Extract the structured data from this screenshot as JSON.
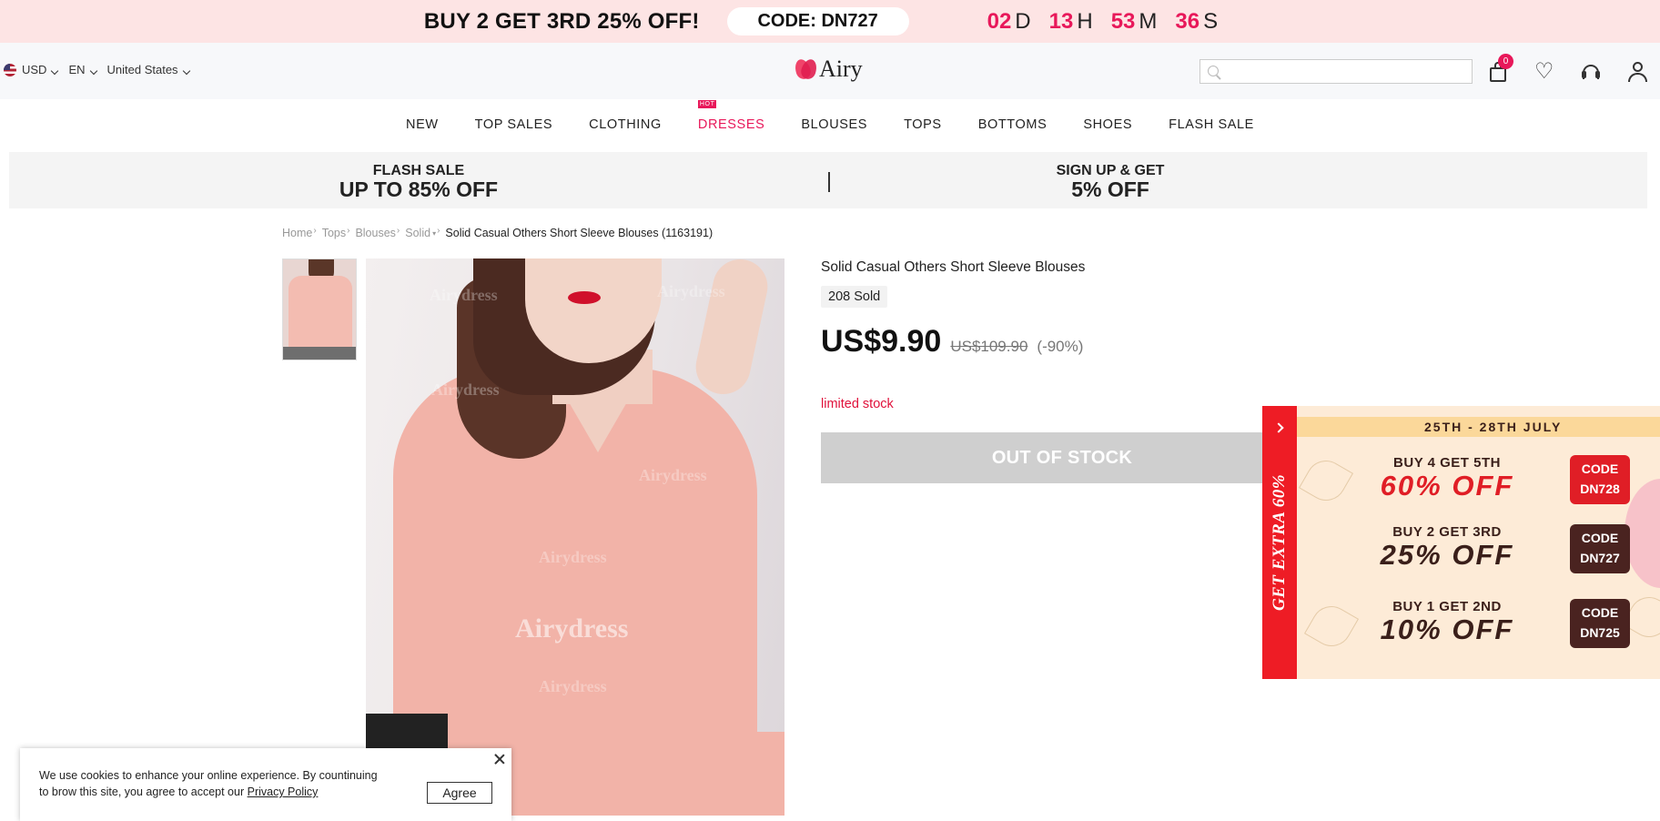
{
  "topbar": {
    "promo": "BUY 2 GET 3RD 25% OFF!",
    "code": "CODE: DN727",
    "countdown": [
      {
        "num": "02",
        "unit": "D"
      },
      {
        "num": "13",
        "unit": "H"
      },
      {
        "num": "53",
        "unit": "M"
      },
      {
        "num": "36",
        "unit": "S"
      }
    ]
  },
  "header": {
    "currency": "USD",
    "language": "EN",
    "country": "United States",
    "logo": "Airy",
    "search_placeholder": "",
    "cart_count": "0",
    "icons": [
      "search-icon",
      "bag-icon",
      "heart-icon",
      "headset-icon",
      "user-icon"
    ]
  },
  "nav": {
    "items": [
      "NEW",
      "TOP SALES",
      "CLOTHING",
      "DRESSES",
      "BLOUSES",
      "TOPS",
      "BOTTOMS",
      "SHOES",
      "FLASH SALE"
    ],
    "hot_tag": "HOT"
  },
  "strip": {
    "left_l1": "FLASH SALE",
    "left_l2": "UP TO 85% OFF",
    "right_l1": "SIGN UP & GET",
    "right_l2": "5% OFF"
  },
  "breadcrumb": {
    "items": [
      "Home",
      "Tops",
      "Blouses",
      "Solid"
    ],
    "current": "Solid Casual Others Short Sleeve Blouses (1163191)"
  },
  "image": {
    "watermark": "Airydress"
  },
  "product": {
    "title": "Solid Casual Others Short Sleeve Blouses",
    "sold": "208 Sold",
    "price": "US$9.90",
    "original_price": "US$109.90",
    "discount": "(-90%)",
    "stock_note": "limited stock",
    "button": "OUT OF STOCK"
  },
  "side_promo": {
    "tab_text": "GET EXTRA 60%",
    "date": "25TH - 28TH JULY",
    "rows": [
      {
        "buy": "BUY 4 GET 5TH",
        "off": "60% OFF",
        "code1": "CODE",
        "code2": "DN728",
        "accent": "#e01e26"
      },
      {
        "buy": "BUY 2 GET 3RD",
        "off": "25% OFF",
        "code1": "CODE",
        "code2": "DN727",
        "accent": "#3a1f1a"
      },
      {
        "buy": "BUY 1 GET 2ND",
        "off": "10% OFF",
        "code1": "CODE",
        "code2": "DN725",
        "accent": "#3a1f1a"
      }
    ]
  },
  "cookie": {
    "text": "We use cookies to enhance your online experience. By countinuing to brow this site, you agree to accept our ",
    "link": "Privacy Policy",
    "agree": "Agree"
  },
  "colors": {
    "accent": "#e8185a",
    "topbar_bg": "#fde4e4",
    "promo_red": "#ee1c25"
  }
}
